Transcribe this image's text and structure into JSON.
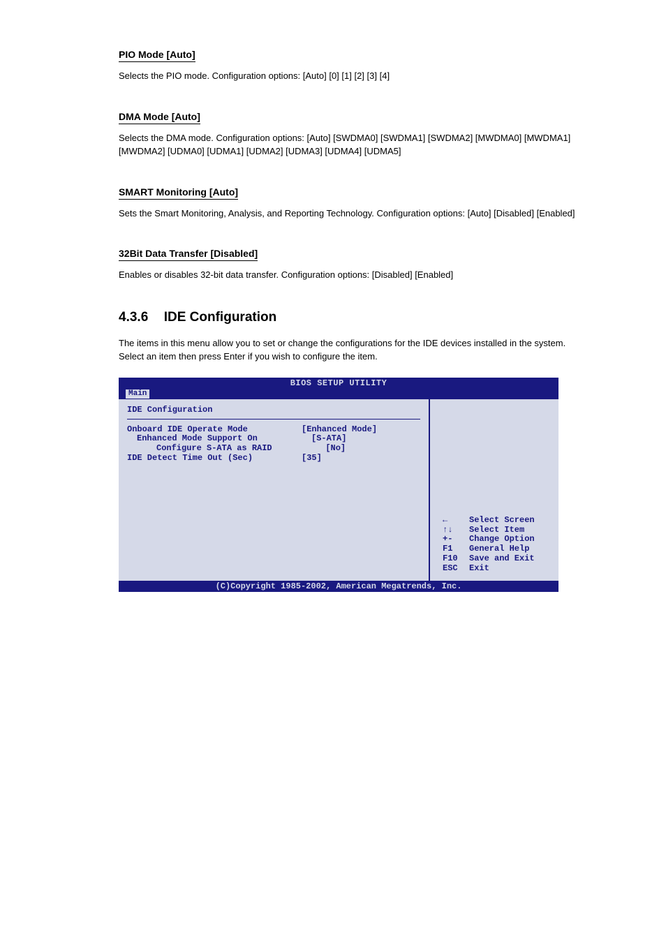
{
  "sections": {
    "pio": {
      "heading": "PIO Mode [Auto]",
      "body": "Selects the PIO mode. Configuration options: [Auto] [0] [1] [2] [3] [4]"
    },
    "dma": {
      "heading": "DMA Mode [Auto]",
      "body": "Selects the DMA mode. Configuration options: [Auto] [SWDMA0] [SWDMA1] [SWDMA2] [MWDMA0] [MWDMA1] [MWDMA2] [UDMA0] [UDMA1] [UDMA2] [UDMA3] [UDMA4] [UDMA5]"
    },
    "smart": {
      "heading": "SMART Monitoring [Auto]",
      "body": "Sets the Smart Monitoring, Analysis, and Reporting Technology. Configuration options: [Auto] [Disabled] [Enabled]"
    },
    "transfer": {
      "heading": "32Bit Data Transfer [Disabled]",
      "body": "Enables or disables 32-bit data transfer. Configuration options: [Disabled] [Enabled]"
    }
  },
  "page_section": {
    "number": "4.3.6",
    "title": "IDE Configuration",
    "body": "The items in this menu allow you to set or change the configurations for the IDE devices installed in the system. Select an item then press Enter if you wish to configure the item."
  },
  "bios": {
    "title": "BIOS SETUP UTILITY",
    "tab": "Main",
    "header": "IDE Configuration",
    "rows": [
      {
        "label": "Onboard IDE Operate Mode",
        "value": "[Enhanced Mode]",
        "indent": 0
      },
      {
        "label": "Enhanced Mode Support On",
        "value": "[S-ATA]",
        "indent": 1
      },
      {
        "label": "Configure S-ATA as RAID",
        "value": "[No]",
        "indent": 2
      },
      {
        "label": "IDE Detect Time Out (Sec)",
        "value": "[35]",
        "indent": 0
      }
    ],
    "help": [
      {
        "key": "←",
        "action": "Select Screen",
        "icon": "arrow-left"
      },
      {
        "key": "↑↓",
        "action": "Select Item",
        "icon": "arrows-updown"
      },
      {
        "key": "+-",
        "action": "Change Option"
      },
      {
        "key": "F1",
        "action": "General Help"
      },
      {
        "key": "F10",
        "action": "Save and Exit"
      },
      {
        "key": "ESC",
        "action": "Exit"
      }
    ],
    "footer": "(C)Copyright 1985-2002, American Megatrends, Inc."
  }
}
